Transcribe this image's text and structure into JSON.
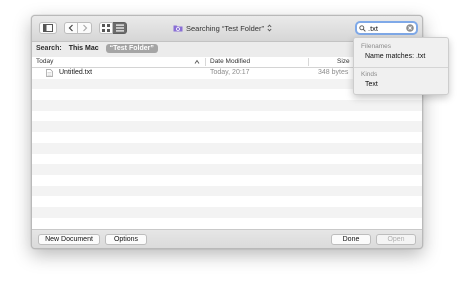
{
  "toolbar": {
    "location_label": "Searching “Test Folder”",
    "search_value": ".txt"
  },
  "scope": {
    "label": "Search:",
    "this_mac": "This Mac",
    "folder": "“Test Folder”"
  },
  "columns": {
    "name": "Today",
    "date": "Date Modified",
    "size": "Size"
  },
  "files": [
    {
      "name": "Untitled.txt",
      "date": "Today, 20:17",
      "size": "348 bytes"
    }
  ],
  "bottom": {
    "new_document": "New Document",
    "options": "Options",
    "done": "Done",
    "open": "Open"
  },
  "suggestions": {
    "filenames_header": "Filenames",
    "filenames_item": "Name matches: .txt",
    "kinds_header": "Kinds",
    "kinds_item": "Text"
  },
  "colors": {
    "search_focus": "#7fa9e8",
    "scope_folder_bg": "#a5a5a5",
    "folder_icon": "#8a6fd6"
  }
}
